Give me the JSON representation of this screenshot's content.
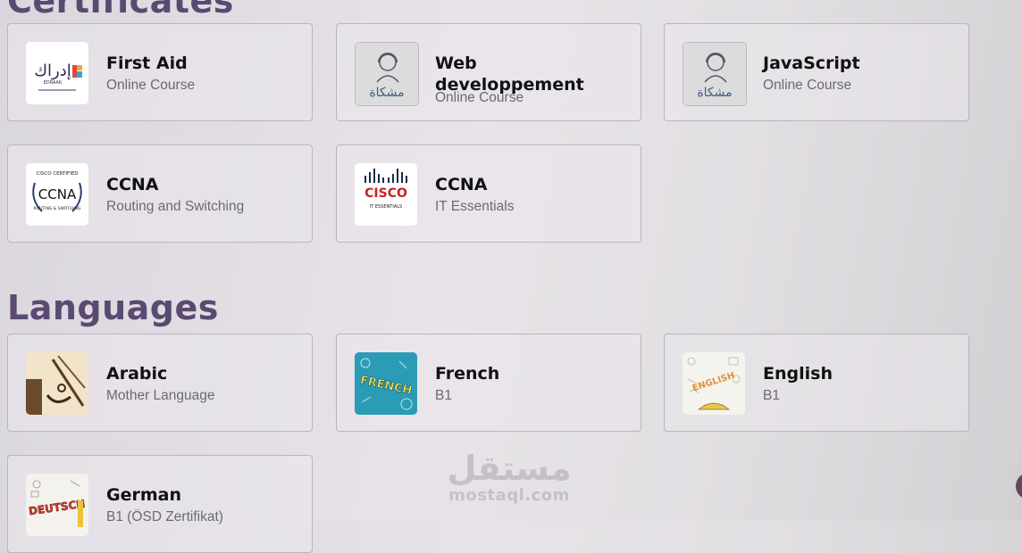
{
  "sections": {
    "certificates": {
      "title": "Certificates"
    },
    "languages": {
      "title": "Languages"
    }
  },
  "certificates": [
    {
      "title": "First Aid",
      "subtitle": "Online Course",
      "icon": "edraak-logo"
    },
    {
      "title": "Web developpement",
      "subtitle": "Online Course",
      "icon": "mishkat-logo"
    },
    {
      "title": "JavaScript",
      "subtitle": "Online Course",
      "icon": "mishkat-logo"
    },
    {
      "title": "CCNA",
      "subtitle": "Routing and Switching",
      "icon": "cisco-certified-ccna-logo"
    },
    {
      "title": "CCNA",
      "subtitle": "IT Essentials",
      "icon": "cisco-it-essentials-logo"
    }
  ],
  "languages": [
    {
      "title": "Arabic",
      "subtitle": "Mother Language",
      "icon": "arabic-calligraphy-image"
    },
    {
      "title": "French",
      "subtitle": "B1",
      "icon": "french-lettering-image"
    },
    {
      "title": "English",
      "subtitle": "B1",
      "icon": "english-doodle-image"
    },
    {
      "title": "German",
      "subtitle": "B1 (ÖSD Zertifikat)",
      "icon": "deutsch-lettering-image"
    }
  ],
  "logo_text": {
    "edraak_ar": "إدراك",
    "edraak_en": "EDRAAK",
    "mishkat_ar": "مشكاة",
    "cisco_certified": "CISCO CERTIFIED",
    "ccna": "CCNA",
    "routing_switching": "ROUTING & SWITCHING",
    "cisco": "CISCO",
    "it_essentials": "IT ESSENTIALS",
    "french_word": "FRENCH",
    "english_word": "ENGLISH",
    "deutsch_word": "DEUTSCH"
  },
  "watermark": {
    "arabic": "مستقل",
    "latin": "mostaql.com"
  },
  "colors": {
    "heading": "#5a4a72",
    "card_border": "#b9b5bb",
    "subtitle": "#6a6a74"
  }
}
